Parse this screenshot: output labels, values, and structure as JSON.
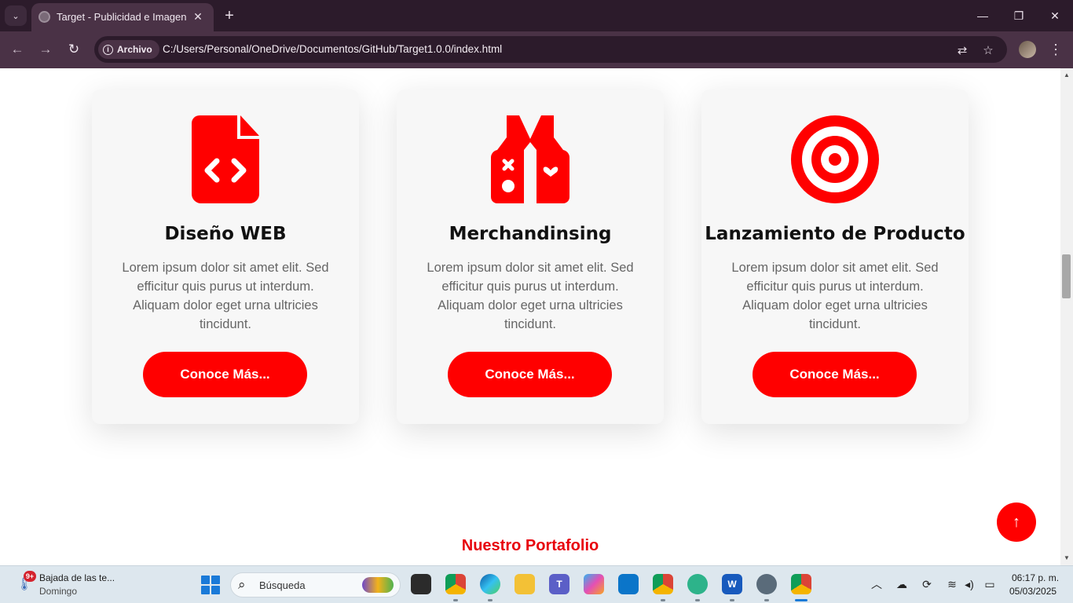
{
  "browser": {
    "tab_title": "Target - Publicidad e Imagen",
    "tab_close": "✕",
    "new_tab": "+",
    "tab_list": "⌄",
    "minimize": "—",
    "restore": "❐",
    "close": "✕",
    "back": "←",
    "forward": "→",
    "reload": "↻",
    "chip_label": "Archivo",
    "url": "C:/Users/Personal/OneDrive/Documentos/GitHub/Target1.0.0/index.html",
    "translate_icon": "⇄",
    "bookmark_icon": "☆",
    "menu": "⋮"
  },
  "page": {
    "cards": [
      {
        "icon": "file-code-icon",
        "title": "Diseño WEB",
        "text": "Lorem ipsum dolor sit amet elit. Sed efficitur quis purus ut interdum. Aliquam dolor eget urna ultricies tincidunt.",
        "button": "Conoce Más..."
      },
      {
        "icon": "vest-patches-icon",
        "title": "Merchandinsing",
        "text": "Lorem ipsum dolor sit amet elit. Sed efficitur quis purus ut interdum. Aliquam dolor eget urna ultricies tincidunt.",
        "button": "Conoce Más..."
      },
      {
        "icon": "bullseye-icon",
        "title": "Lanzamiento de Producto",
        "text": "Lorem ipsum dolor sit amet elit. Sed efficitur quis purus ut interdum. Aliquam dolor eget urna ultricies tincidunt.",
        "button": "Conoce Más..."
      }
    ],
    "portfolio_title": "Nuestro Portafolio",
    "back_to_top": "↑",
    "accent_color": "#ff0000"
  },
  "taskbar": {
    "weather_badge": "9+",
    "weather_title": "Bajada de las te...",
    "weather_sub": "Domingo",
    "search_placeholder": "Búsqueda",
    "time": "06:17 p. m.",
    "date": "05/03/2025"
  }
}
